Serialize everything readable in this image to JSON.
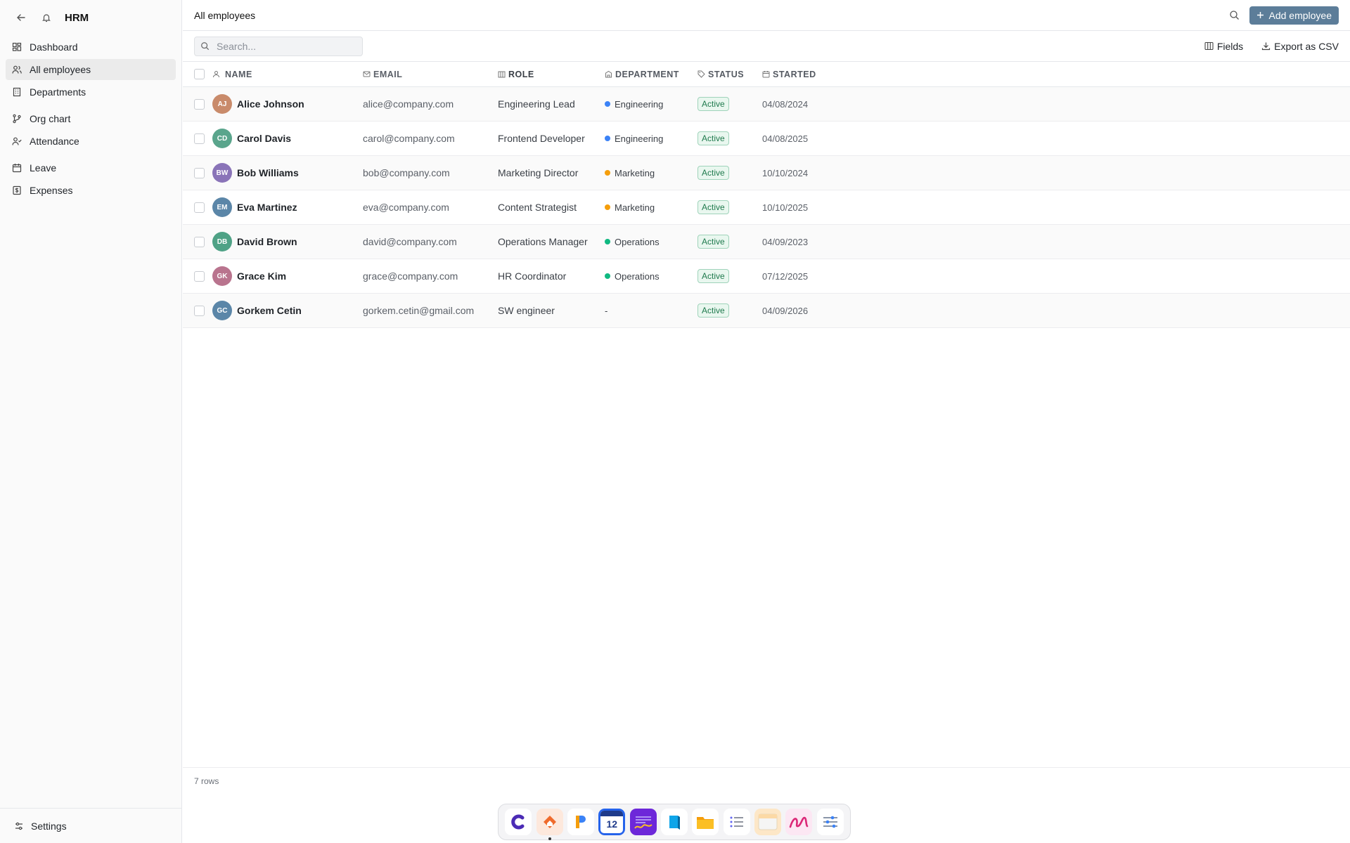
{
  "app": {
    "title": "HRM"
  },
  "sidebar": {
    "items": [
      {
        "label": "Dashboard",
        "icon": "dashboard-icon"
      },
      {
        "label": "All employees",
        "icon": "users-icon",
        "active": true
      },
      {
        "label": "Departments",
        "icon": "building-icon"
      },
      {
        "label": "Org chart",
        "icon": "git-branch-icon"
      },
      {
        "label": "Attendance",
        "icon": "user-check-icon"
      },
      {
        "label": "Leave",
        "icon": "calendar-icon"
      },
      {
        "label": "Expenses",
        "icon": "receipt-icon"
      }
    ],
    "settings_label": "Settings"
  },
  "header": {
    "title": "All employees",
    "add_label": "Add employee"
  },
  "toolbar": {
    "search_placeholder": "Search...",
    "fields_label": "Fields",
    "export_label": "Export as CSV"
  },
  "table": {
    "columns": [
      "NAME",
      "EMAIL",
      "ROLE",
      "DEPARTMENT",
      "STATUS",
      "STARTED"
    ],
    "rows": [
      {
        "initials": "AJ",
        "avatar_color": "#c98b6b",
        "name": "Alice Johnson",
        "email": "alice@company.com",
        "role": "Engineering Lead",
        "department": "Engineering",
        "dept_color": "#3b82f6",
        "status": "Active",
        "started": "04/08/2024"
      },
      {
        "initials": "CD",
        "avatar_color": "#5aa58c",
        "name": "Carol Davis",
        "email": "carol@company.com",
        "role": "Frontend Developer",
        "department": "Engineering",
        "dept_color": "#3b82f6",
        "status": "Active",
        "started": "04/08/2025"
      },
      {
        "initials": "BW",
        "avatar_color": "#8a74b8",
        "name": "Bob Williams",
        "email": "bob@company.com",
        "role": "Marketing Director",
        "department": "Marketing",
        "dept_color": "#f59e0b",
        "status": "Active",
        "started": "10/10/2024"
      },
      {
        "initials": "EM",
        "avatar_color": "#5b86a8",
        "name": "Eva Martinez",
        "email": "eva@company.com",
        "role": "Content Strategist",
        "department": "Marketing",
        "dept_color": "#f59e0b",
        "status": "Active",
        "started": "10/10/2025"
      },
      {
        "initials": "DB",
        "avatar_color": "#4fa286",
        "name": "David Brown",
        "email": "david@company.com",
        "role": "Operations Manager",
        "department": "Operations",
        "dept_color": "#10b981",
        "status": "Active",
        "started": "04/09/2023"
      },
      {
        "initials": "GK",
        "avatar_color": "#b9748e",
        "name": "Grace Kim",
        "email": "grace@company.com",
        "role": "HR Coordinator",
        "department": "Operations",
        "dept_color": "#10b981",
        "status": "Active",
        "started": "07/12/2025"
      },
      {
        "initials": "GC",
        "avatar_color": "#5b86a8",
        "name": "Gorkem Cetin",
        "email": "gorkem.cetin@gmail.com",
        "role": "SW engineer",
        "department": "-",
        "dept_color": "",
        "status": "Active",
        "started": "04/09/2026"
      }
    ],
    "row_count_label": "7 rows"
  },
  "dock": {
    "apps": [
      "c-app-icon",
      "home-app-icon",
      "p-app-icon",
      "calendar-app-icon",
      "wave-app-icon",
      "book-app-icon",
      "folder-app-icon",
      "list-app-icon",
      "window-app-icon",
      "scribble-app-icon",
      "sliders-app-icon"
    ],
    "calendar_day": "12"
  }
}
